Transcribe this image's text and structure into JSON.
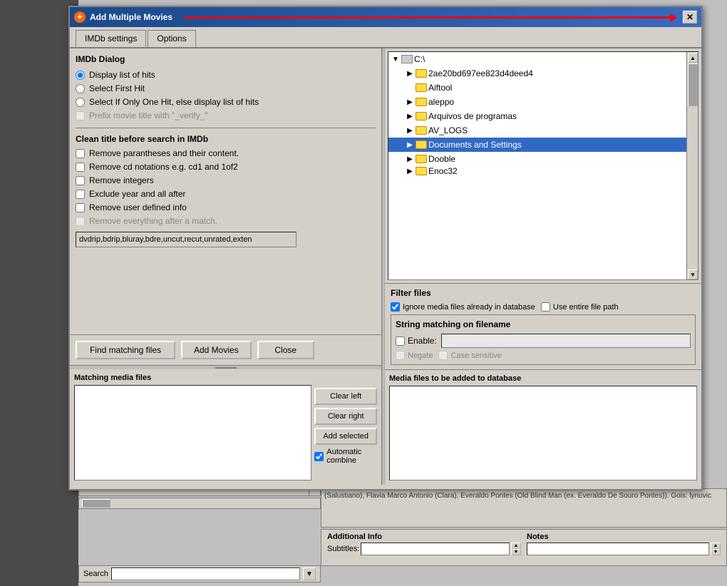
{
  "dialog": {
    "title": "Add Multiple Movies",
    "close_label": "✕"
  },
  "tabs": {
    "imdb_settings": "IMDb settings",
    "options": "Options"
  },
  "imdb_dialog": {
    "section_title": "IMDb Dialog",
    "radio_options": [
      {
        "id": "r1",
        "label": "Display list of hits",
        "checked": true
      },
      {
        "id": "r2",
        "label": "Select First Hit",
        "checked": false
      },
      {
        "id": "r3",
        "label": "Select If Only One Hit, else display list of hits",
        "checked": false
      }
    ],
    "prefix_label": "Prefix movie title with \"_verify_\"",
    "prefix_disabled": true
  },
  "clean_title": {
    "section_title": "Clean title before search in IMDb",
    "checkboxes": [
      {
        "id": "c1",
        "label": "Remove parantheses and their content.",
        "checked": false
      },
      {
        "id": "c2",
        "label": "Remove cd notations e.g. cd1 and 1of2",
        "checked": false
      },
      {
        "id": "c3",
        "label": "Remove integers",
        "checked": false
      },
      {
        "id": "c4",
        "label": "Exclude year and all after",
        "checked": false
      },
      {
        "id": "c5",
        "label": "Remove user defined info",
        "checked": false
      },
      {
        "id": "c6",
        "label": "Remove everything after a match.",
        "checked": false,
        "disabled": true
      }
    ],
    "text_input_value": "dvdrip,bdrip,bluray,bdre,uncut,recut,unrated,exten"
  },
  "buttons": {
    "find_matching": "Find matching files",
    "add_movies": "Add Movies",
    "close": "Close"
  },
  "file_browser": {
    "root": "C:\\",
    "items": [
      {
        "name": "2ae20bd697ee823d4deed4",
        "expandable": true,
        "indent": 1
      },
      {
        "name": "Aiftool",
        "expandable": false,
        "indent": 1
      },
      {
        "name": "aleppo",
        "expandable": true,
        "indent": 1
      },
      {
        "name": "Arquivos de programas",
        "expandable": true,
        "indent": 1
      },
      {
        "name": "AV_LOGS",
        "expandable": true,
        "indent": 1
      },
      {
        "name": "Documents and Settings",
        "expandable": true,
        "indent": 1
      },
      {
        "name": "Dooble",
        "expandable": true,
        "indent": 1
      },
      {
        "name": "Enoc32",
        "expandable": true,
        "indent": 1
      }
    ]
  },
  "filter_files": {
    "title": "Filter files",
    "ignore_media_label": "Ignore media files already in database",
    "ignore_media_checked": true,
    "use_entire_path_label": "Use entire file path",
    "use_entire_path_checked": false,
    "string_matching_title": "String matching on filename",
    "enable_label": "Enable:",
    "enable_checked": false,
    "negate_label": "Negate",
    "negate_checked": false,
    "case_sensitive_label": "Case sensitive",
    "case_sensitive_checked": false
  },
  "split_panel": {
    "left_title": "Matching media files",
    "right_title": "Media files to be added to database",
    "clear_left": "Clear left",
    "clear_right": "Clear right",
    "add_selected": "Add selected",
    "auto_combine_label": "Automatic combine",
    "auto_combine_checked": true
  },
  "additional_info": {
    "label": "Additional Info",
    "subtitle_label": "Subtitles:",
    "notes_label": "Notes"
  },
  "bottom_text": "(Salustiano), Flavia Marco Antonio (Clara), Everaldo Pontes (Old Blind Man (ex. Everaldo De Souro Pontes)). Gois: lynuvic",
  "search": {
    "label": "Search"
  }
}
